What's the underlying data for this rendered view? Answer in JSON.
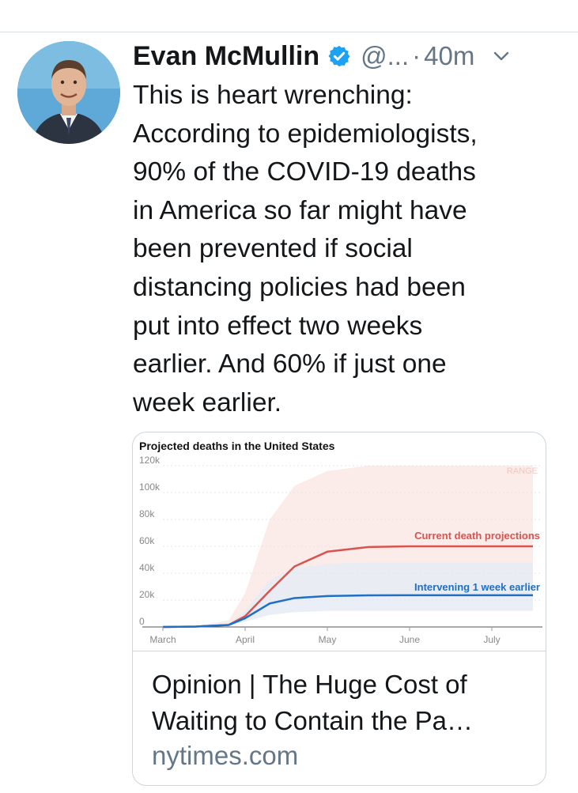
{
  "tweet": {
    "author_name": "Evan McMullin",
    "handle": "@...",
    "separator": "·",
    "time": "40m",
    "text": "This is heart wrenching:\nAccording to epidemiologists,\n90% of the COVID-19 deaths\nin America so far might have\nbeen prevented if social\ndistancing policies had been\nput into effect two weeks\nearlier. And 60% if just one\nweek earlier."
  },
  "colors": {
    "verified": "#1da1f2",
    "current_line": "#d9534f",
    "intervening_line": "#1f6fc5",
    "range_fill": "#fbe9e7",
    "intervening_fill": "#e6ecf6"
  },
  "icons": {
    "verified": "verified-badge-icon",
    "menu": "chevron-down-icon"
  },
  "card": {
    "title": "Opinion | The Huge Cost of Waiting to Contain the Pa…",
    "domain": "nytimes.com"
  },
  "chart_data": {
    "type": "line",
    "title": "Projected deaths in the United States",
    "x_labels": [
      "March",
      "April",
      "May",
      "June",
      "July"
    ],
    "y_ticks": [
      "0",
      "20k",
      "40k",
      "60k",
      "80k",
      "100k",
      "120k"
    ],
    "ylim": [
      0,
      120000
    ],
    "range_label": "RANGE",
    "series": [
      {
        "name": "Current death projections",
        "x": [
          0,
          0.4,
          0.8,
          1.0,
          1.3,
          1.6,
          2.0,
          2.5,
          3.0,
          4.5
        ],
        "values": [
          0,
          300,
          1500,
          8000,
          27000,
          45000,
          56000,
          59500,
          60000,
          60000
        ]
      },
      {
        "name": "Intervening 1 week earlier",
        "x": [
          0,
          0.4,
          0.8,
          1.0,
          1.3,
          1.6,
          2.0,
          2.5,
          3.0,
          4.5
        ],
        "values": [
          0,
          300,
          1500,
          6500,
          17500,
          21500,
          23000,
          23500,
          23600,
          23600
        ]
      }
    ],
    "bands": [
      {
        "series": "Current death projections",
        "upper": [
          0,
          500,
          5000,
          25000,
          80000,
          105000,
          116000,
          120000,
          120000,
          120000
        ],
        "lower": [
          0,
          300,
          1000,
          5000,
          14000,
          20000,
          22000,
          23000,
          23000,
          23000
        ]
      },
      {
        "series": "Intervening 1 week earlier",
        "upper": [
          0,
          400,
          2500,
          12000,
          35000,
          44000,
          47000,
          48000,
          48000,
          48000
        ],
        "lower": [
          0,
          200,
          800,
          4000,
          9000,
          11000,
          12000,
          12000,
          12000,
          12000
        ]
      }
    ]
  }
}
